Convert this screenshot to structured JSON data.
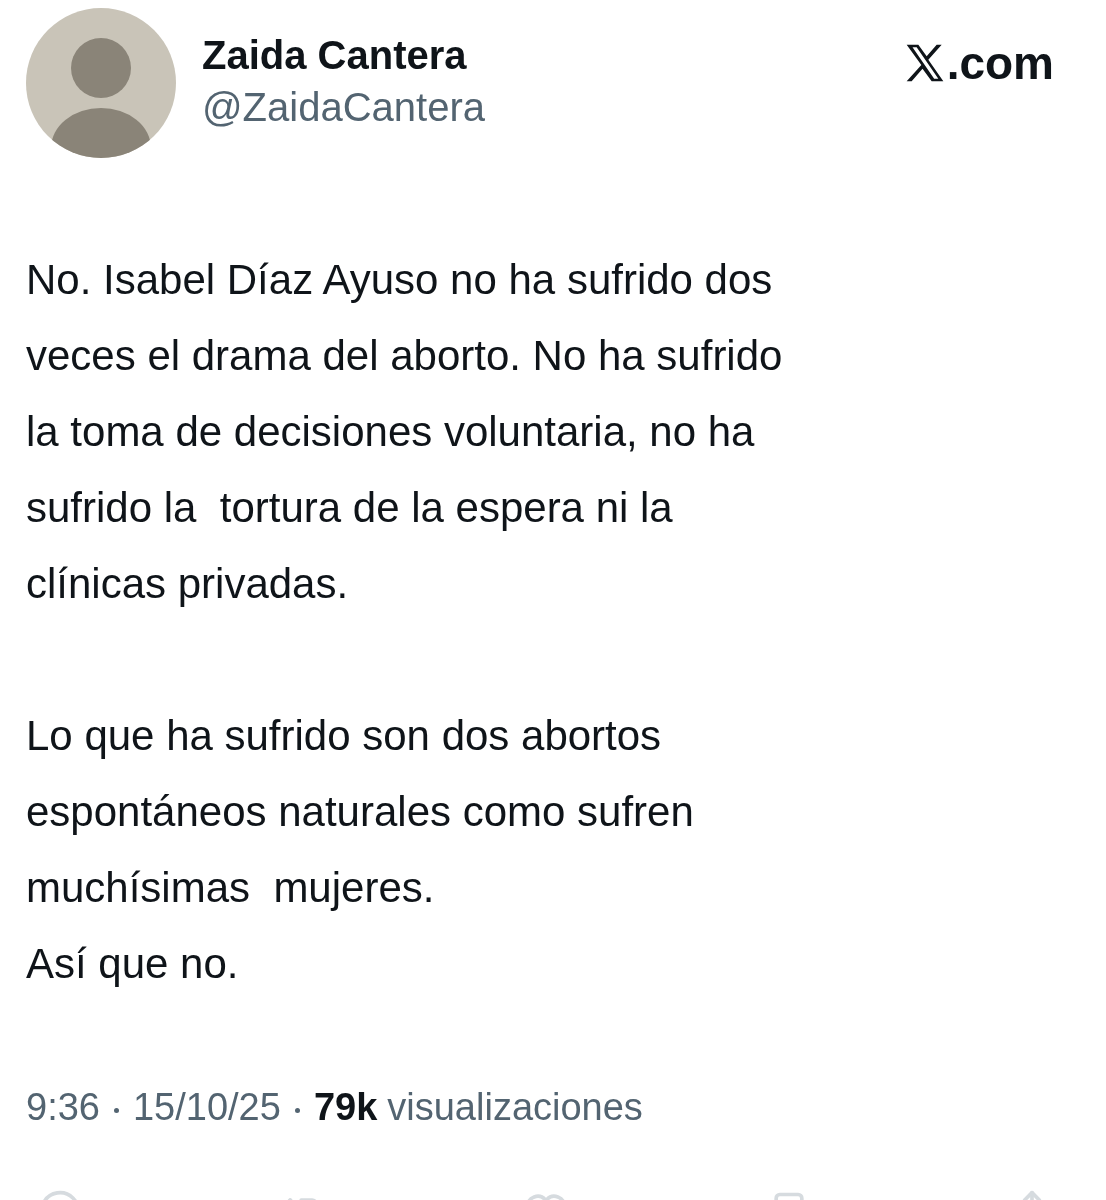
{
  "author": {
    "name": "Zaida Cantera",
    "handle": "@ZaidaCantera"
  },
  "source": {
    "domain": ".com"
  },
  "body": [
    [
      "No. Isabel Díaz Ayuso no ha sufrido dos",
      "veces el drama del aborto. No ha sufrido",
      "la toma de decisiones voluntaria, no ha",
      "sufrido la  tortura de la espera ni la",
      "clínicas privadas."
    ],
    [
      "Lo que ha sufrido son dos abortos",
      "espontáneos naturales como sufren",
      "muchísimas  mujeres.",
      "Así que no."
    ]
  ],
  "meta": {
    "time": "9:36",
    "date": "15/10/25",
    "views_count": "79k",
    "views_label": "visualizaciones"
  }
}
